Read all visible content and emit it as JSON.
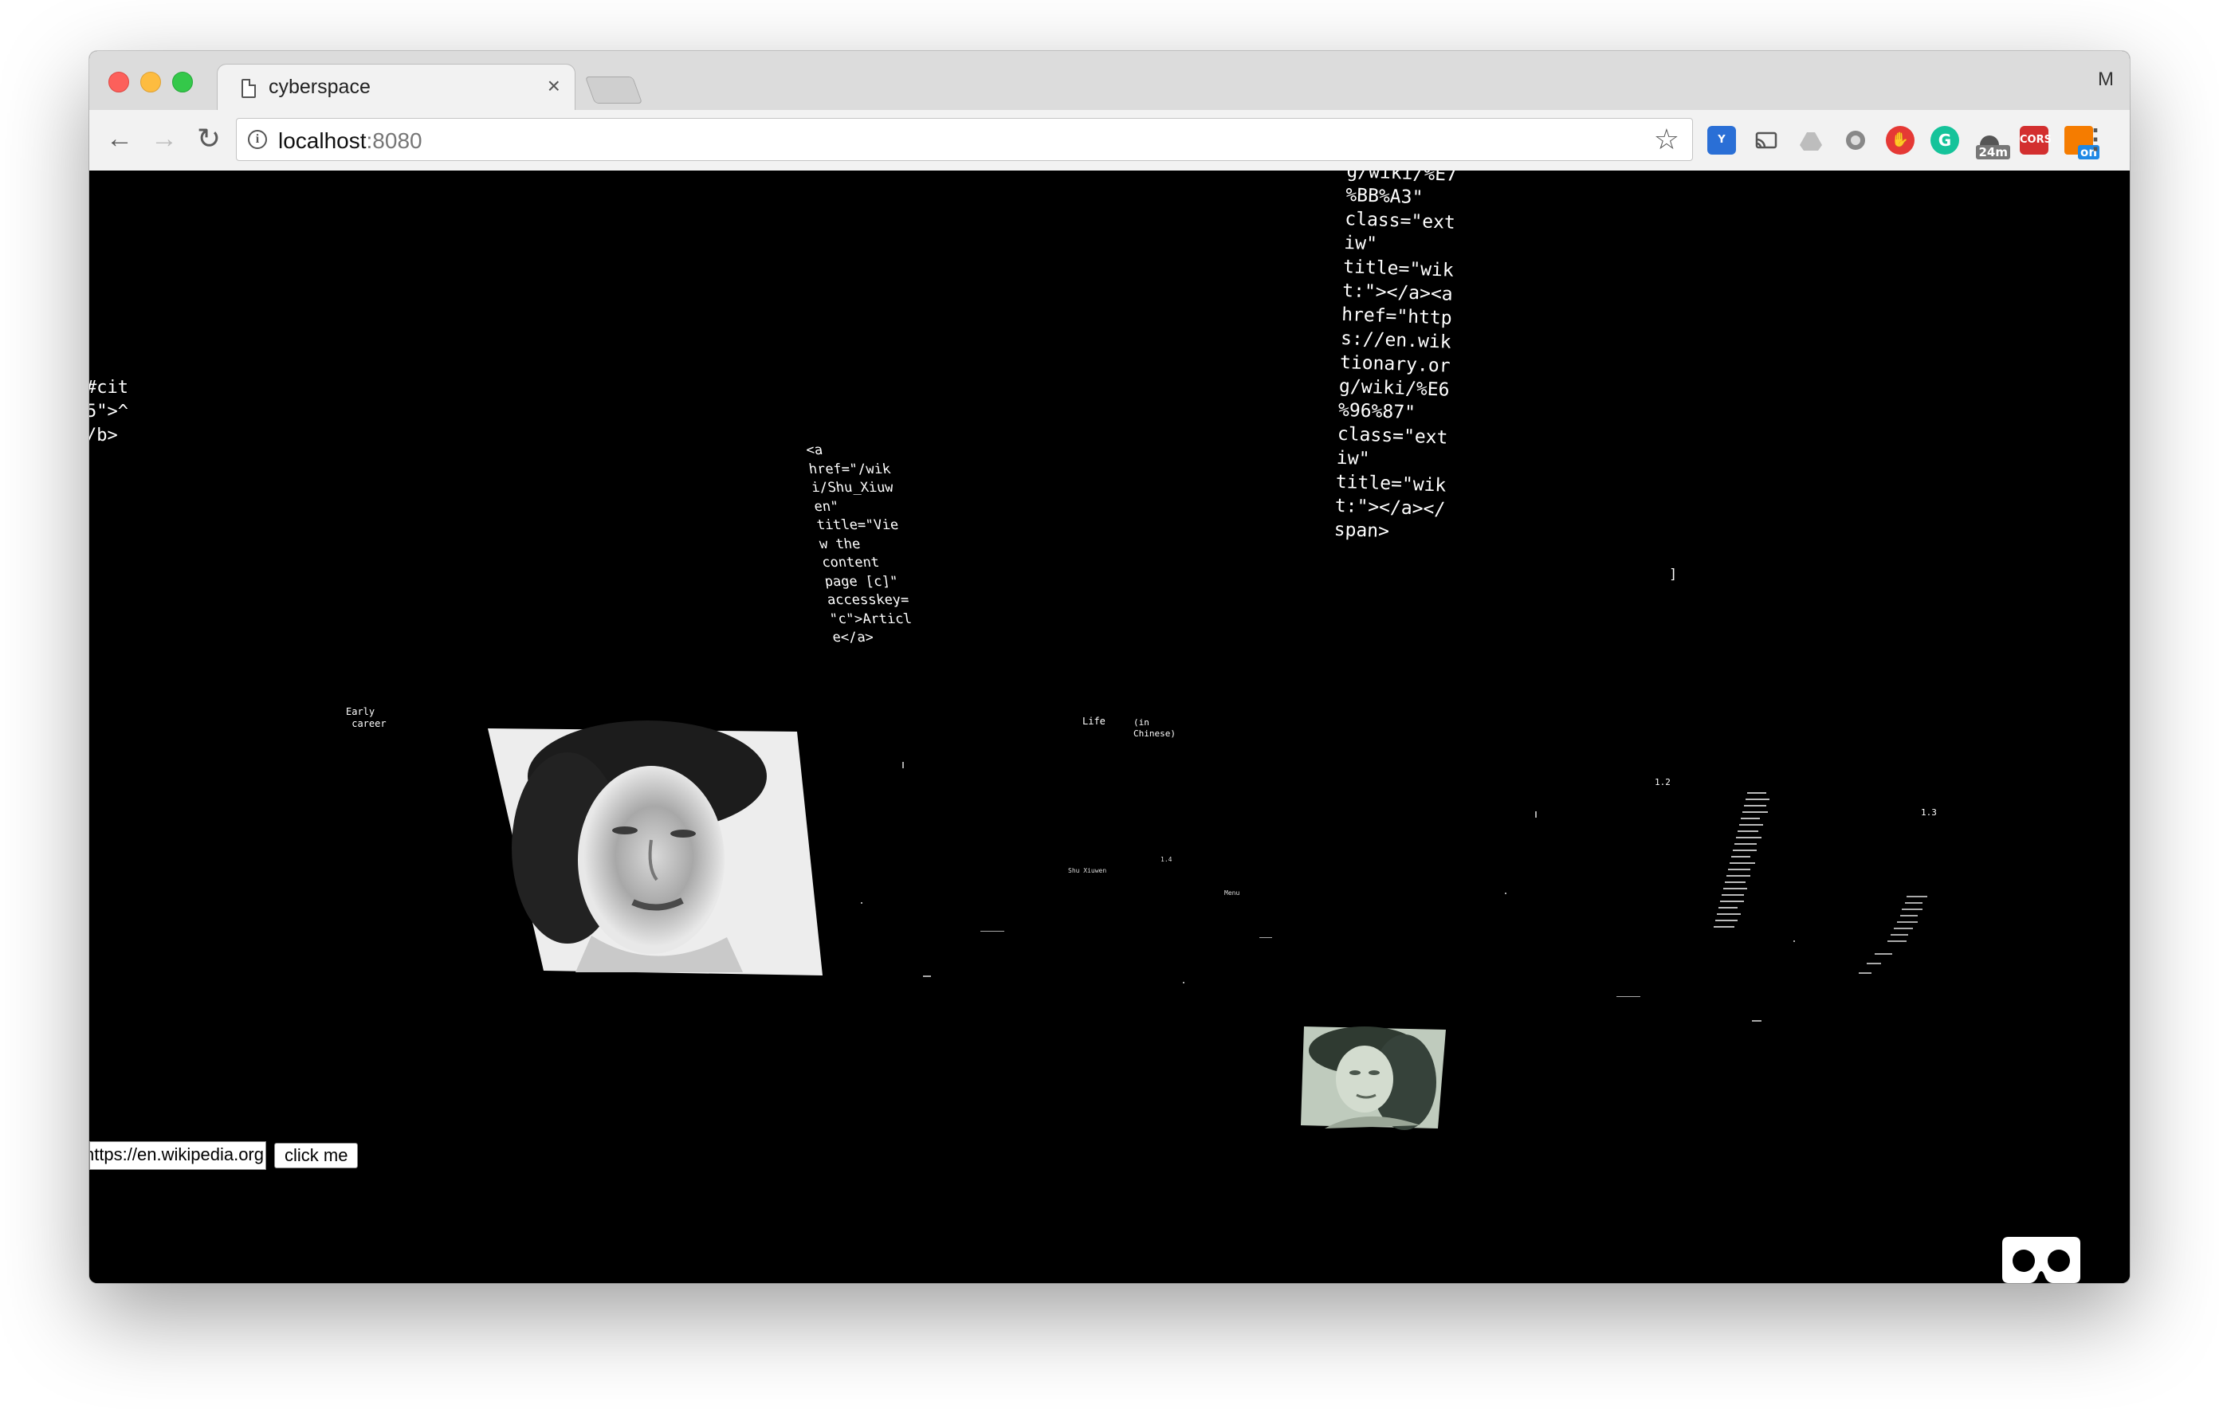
{
  "browser": {
    "tab_title": "cyberspace",
    "tab_close": "×",
    "profile_letter": "M",
    "url_host": "localhost",
    "url_port": ":8080",
    "nav": {
      "back": "←",
      "forward": "→",
      "reload": "↻"
    },
    "star": "☆",
    "menu": "⋮",
    "extensions": [
      {
        "name": "vivaldi-v-icon",
        "label": "Y",
        "color": "#2a6fd6"
      },
      {
        "name": "cast-icon",
        "label": "",
        "color": "#f2f2f2"
      },
      {
        "name": "drive-icon",
        "label": "",
        "color": "#f2f2f2"
      },
      {
        "name": "globe-icon",
        "label": "",
        "color": "#f2f2f2"
      },
      {
        "name": "adblock-icon",
        "label": "",
        "color": "#e53935"
      },
      {
        "name": "grammarly-icon",
        "label": "G",
        "color": "#15c39a"
      },
      {
        "name": "timer-icon",
        "label": "24m",
        "color": "#777777"
      },
      {
        "name": "cors-icon",
        "label": "CORS",
        "color": "#d32f2f"
      },
      {
        "name": "toggle-on-icon",
        "label": "on",
        "color": "#f57c00"
      }
    ]
  },
  "scene": {
    "code_top_right": "g/wiki/%E7\n%BB%A3\"\nclass=\"ext\niw\"\ntitle=\"wik\nt:\"></a><a\nhref=\"http\ns://en.wik\ntionary.or\ng/wiki/%E6\n%96%87\"\nclass=\"ext\niw\"\ntitle=\"wik\nt:\"></a></\nspan>",
    "code_center": "<a\nhref=\"/wik\ni/Shu_Xiuw\nen\"\ntitle=\"Vie\nw the\ncontent\npage [c]\"\naccesskey=\n\"c\">Articl\ne</a>",
    "code_left": "#cit\n5\">^\n/b>",
    "bracket_right": "]",
    "label_early_career": "Early\n career",
    "label_life": "Life",
    "label_in_chinese": "(in\nChinese)",
    "label_1_2": "1.2",
    "label_1_3": "1.3",
    "label_1_4": "1.4",
    "label_shu_xiuwen": "Shu Xiuwen",
    "label_menu": "Menu",
    "url_input_value": "https://en.wikipedia.org/",
    "button_label": "click me"
  }
}
